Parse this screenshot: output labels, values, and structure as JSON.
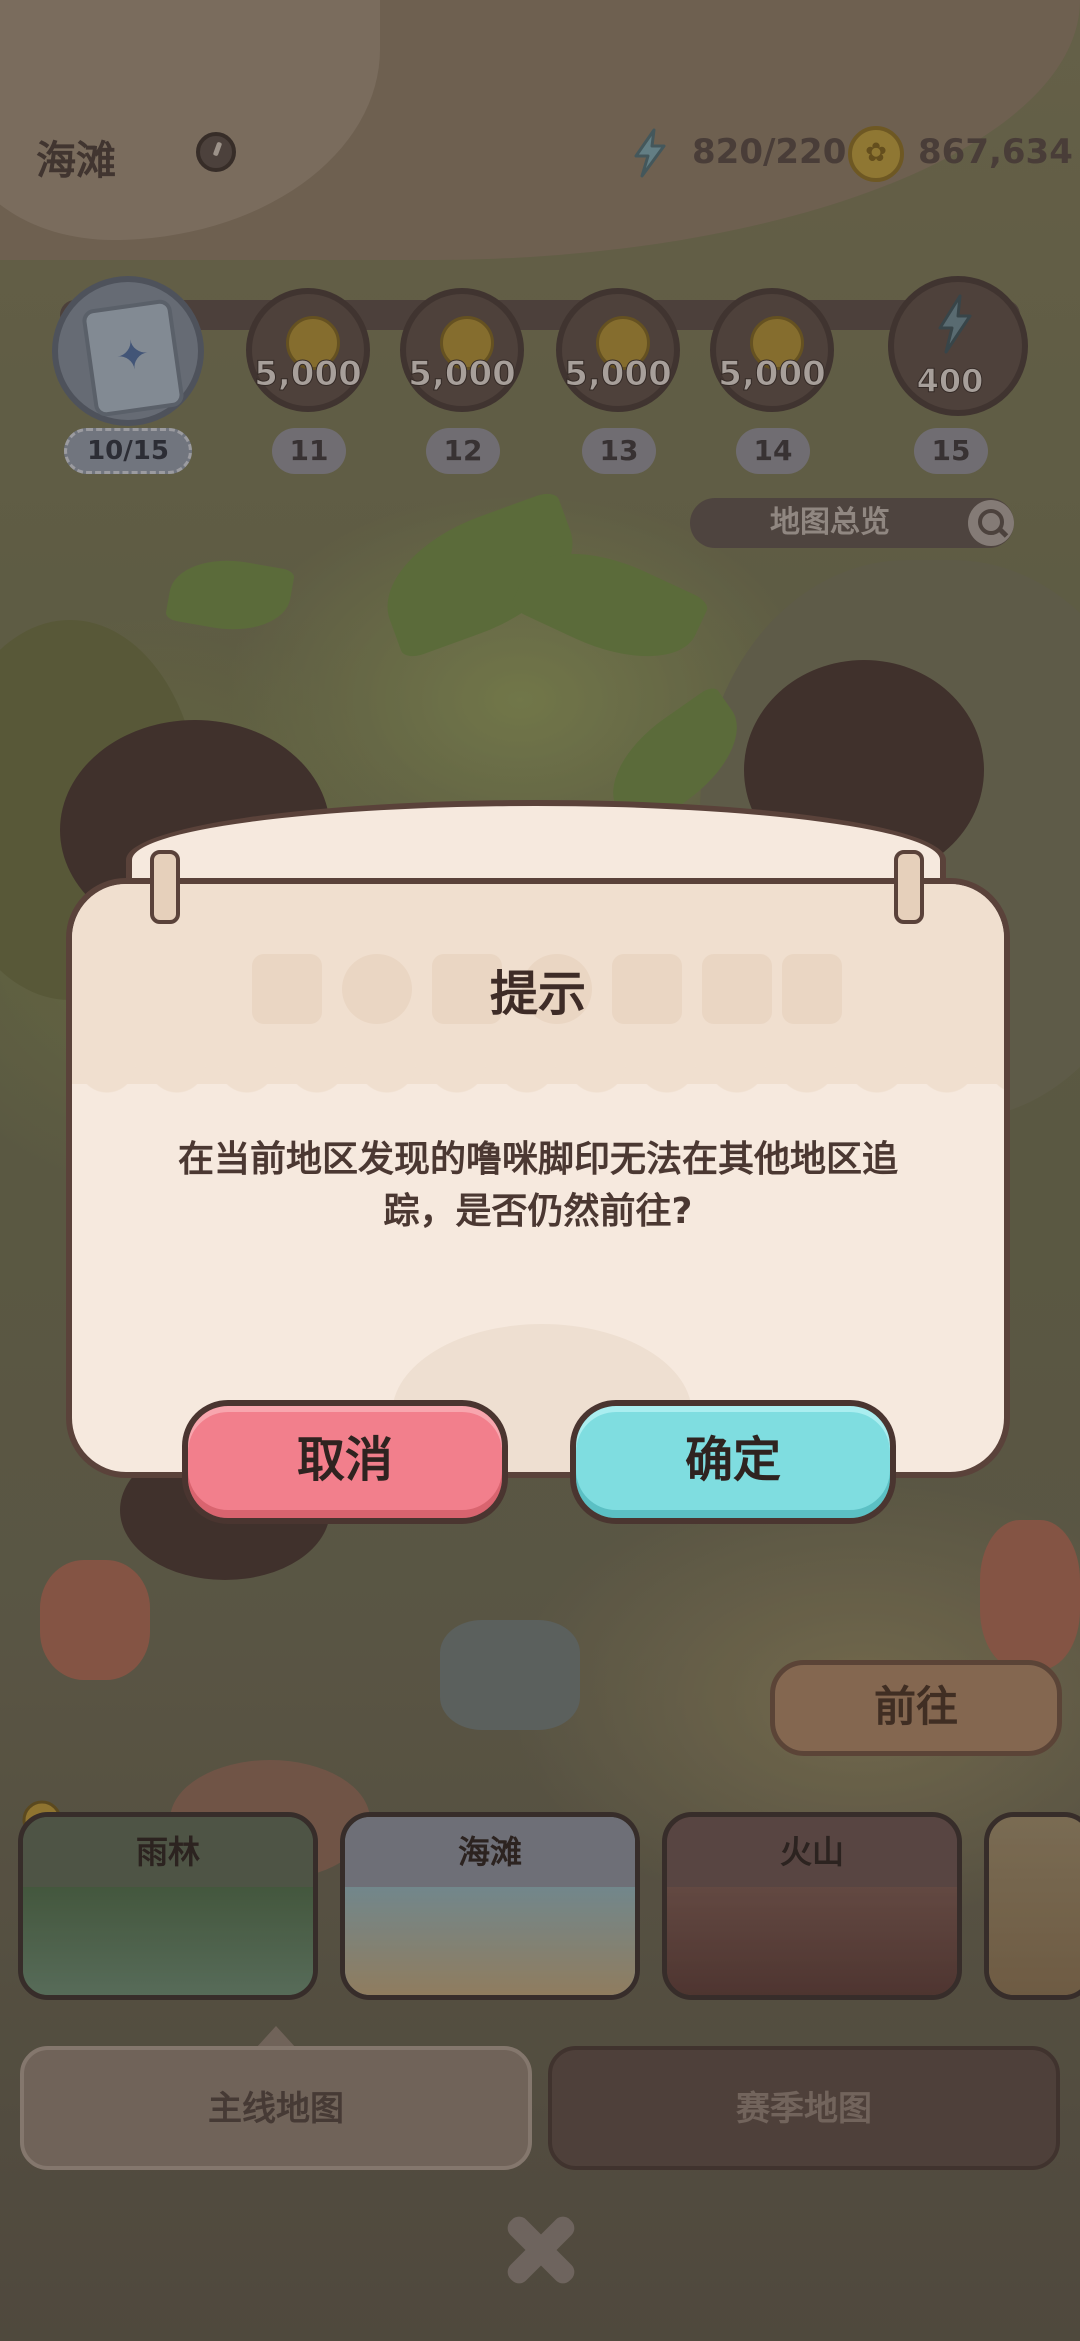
{
  "header": {
    "region_name": "海滩",
    "energy": "820/220",
    "coins": "867,634"
  },
  "reward_track": {
    "progress": "10/15",
    "rewards": [
      {
        "amount": "5,000",
        "level": "11",
        "type": "coin"
      },
      {
        "amount": "5,000",
        "level": "12",
        "type": "coin"
      },
      {
        "amount": "5,000",
        "level": "13",
        "type": "coin"
      },
      {
        "amount": "5,000",
        "level": "14",
        "type": "coin"
      },
      {
        "amount": "400",
        "level": "15",
        "type": "energy"
      }
    ],
    "overview_label": "地图总览"
  },
  "dialog": {
    "title": "提示",
    "message_line1": "在当前地区发现的噜咪脚印无法在其他地区追",
    "message_line2": "踪，是否仍然前往?",
    "cancel_label": "取消",
    "confirm_label": "确定"
  },
  "bottom": {
    "go_label": "前往",
    "regions": [
      {
        "name": "雨林",
        "color": "#4f7a5a"
      },
      {
        "name": "海滩",
        "color": "#8aa8b5"
      },
      {
        "name": "火山",
        "color": "#6e4a44"
      }
    ],
    "tabs": {
      "main": "主线地图",
      "season": "赛季地图"
    }
  },
  "colors": {
    "cancel": "#f27f8c",
    "confirm": "#7fdde0",
    "dialog_bg": "#f6e9de",
    "outline": "#5a423a"
  }
}
